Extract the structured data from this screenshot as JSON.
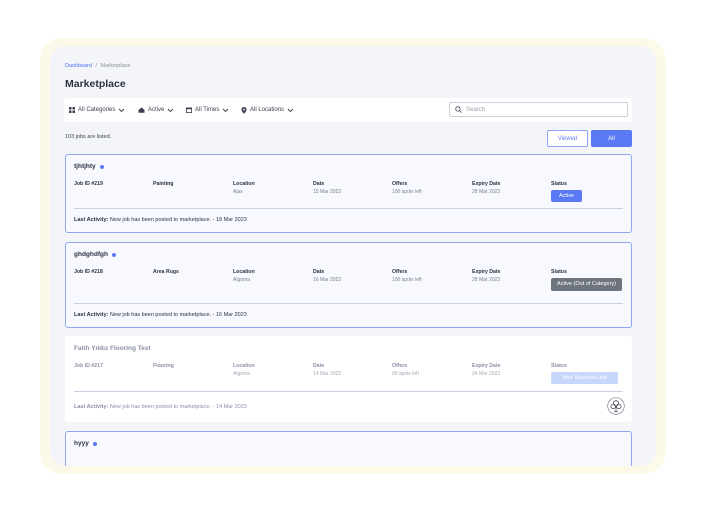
{
  "breadcrumb": {
    "link": "Dashboard",
    "separator": "/",
    "current": "Marketplace"
  },
  "page_title": "Marketplace",
  "filters": [
    {
      "label": "All Categories",
      "icon": "grid-icon"
    },
    {
      "label": "Active",
      "icon": "home-icon"
    },
    {
      "label": "All Times",
      "icon": "calendar-icon"
    },
    {
      "label": "All Locations",
      "icon": "location-pin-icon"
    }
  ],
  "search": {
    "placeholder": "Search"
  },
  "jobs_count_text": "103 jobs are listed.",
  "view_toggle": {
    "viewed": "Viewed",
    "all": "All"
  },
  "columns": {
    "location": "Location",
    "date": "Date",
    "offers": "Offers",
    "expiry": "Expiry Date",
    "status": "Status"
  },
  "activity_label": "Last Activity:",
  "colors": {
    "accent": "#5a79f5",
    "card_bg": "#f3f5f9",
    "gray_badge": "#6d747e",
    "light_badge": "#c7d6fb"
  },
  "jobs": [
    {
      "title": "tjhtjhty",
      "job_id": "Job ID #219",
      "category": "Painting",
      "location": "Ajax",
      "date": "15 Mar 2023",
      "offers": "100 spots left",
      "expiry": "28 Mar 2023",
      "status": "Active",
      "activity": "New job has been posted to marketplace. - 18 Mar 2023"
    },
    {
      "title": "ghdghdfgh",
      "job_id": "Job ID #218",
      "category": "Area Rugs",
      "location": "Algoma",
      "date": "16 Mar 2023",
      "offers": "100 spots left",
      "expiry": "28 Mar 2023",
      "status": "Active (Out of Category)",
      "activity": "New job has been posted to marketplace. - 16 Mar 2023"
    },
    {
      "title": "Fatih Yıldız Flooring Test",
      "job_id": "Job ID #217",
      "category": "Flooring",
      "location": "Algoma",
      "date": "14 Mar 2023",
      "offers": "99 spots left",
      "expiry": "24 Mar 2023",
      "status": "Your Business Job",
      "activity": "New job has been posted to marketplace. - 14 Mar 2023"
    },
    {
      "title": "hyyy"
    }
  ]
}
